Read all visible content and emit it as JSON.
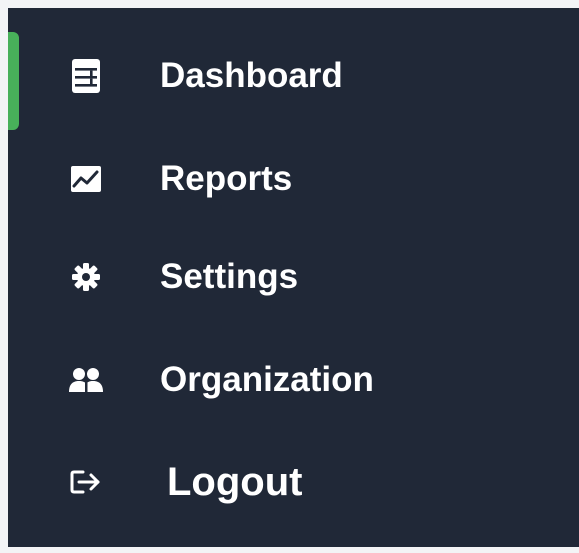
{
  "sidebar": {
    "accent_color": "#48b05a",
    "background_color": "#202837",
    "active_item": "Dashboard",
    "items": [
      {
        "label": "Dashboard",
        "icon": "dashboard-icon"
      },
      {
        "label": "Reports",
        "icon": "reports-chart-icon"
      },
      {
        "label": "Settings",
        "icon": "gear-icon"
      },
      {
        "label": "Organization",
        "icon": "users-icon"
      },
      {
        "label": "Logout",
        "icon": "logout-icon"
      }
    ]
  }
}
